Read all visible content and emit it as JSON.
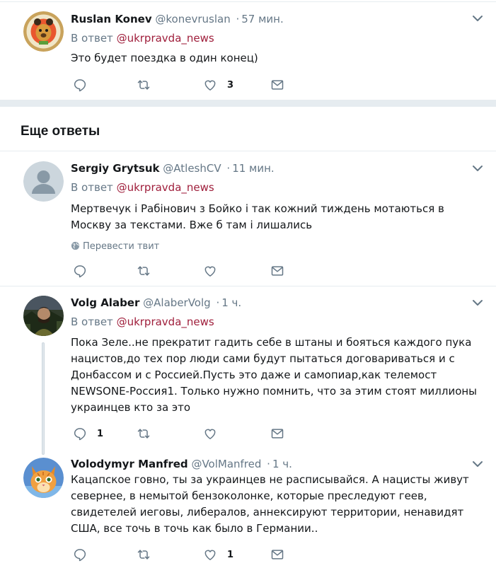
{
  "reply_prefix": "В ответ",
  "section_title": "Еще ответы",
  "translate_label": "Перевести твит",
  "colors": {
    "mention": "#9f1e3b",
    "secondary": "#657786",
    "separator": "#e6ecf0"
  },
  "tweets": [
    {
      "name": "Ruslan Konev",
      "handle": "@konevruslan",
      "dot": "·",
      "time": "57 мин.",
      "mention": "@ukrpravda_news",
      "text": "Это будет поездка в один конец)",
      "replies": "",
      "retweets": "",
      "likes": "3",
      "avatar_icon": "bear-logo-avatar"
    },
    {
      "name": "Sergiy Grytsuk",
      "handle": "@AtleshCV",
      "dot": "·",
      "time": "11 мин.",
      "mention": "@ukrpravda_news",
      "text": "Мертвечук і Рабінович з Бойко і так кожний тиждень мотаються в Москву за текстами. Вже б там і лишались",
      "replies": "",
      "retweets": "",
      "likes": "",
      "avatar_icon": "default-user-avatar"
    },
    {
      "name": "Volg Alaber",
      "handle": "@AlaberVolg",
      "dot": "·",
      "time": "1 ч.",
      "mention": "@ukrpravda_news",
      "text": "Пока Зеле..не прекратит гадить себе в штаны и бояться каждого пука нацистов,до тех пор люди сами будут пытаться договариваться и с Донбассом и с Россией.Пусть это даже и самопиар,как телемост NEWSONE-Россия1. Только нужно помнить, что за этим стоят миллионы украинцев кто за это",
      "replies": "1",
      "retweets": "",
      "likes": "",
      "avatar_icon": "photo-avatar"
    },
    {
      "name": "Volodymyr Manfred",
      "handle": "@VolManfred",
      "dot": "·",
      "time": "1 ч.",
      "text": "Кацапское говно, ты за украинцев не расписывайся. А нацисты живут севернее, в немытой бензоколонке, которые преследуют геев, свидетелей иеговы, либералов, аннексируют территории, ненавидят США, все точь в точь как было в Германии..",
      "replies": "",
      "retweets": "",
      "likes": "1",
      "avatar_icon": "cat-avatar"
    }
  ]
}
